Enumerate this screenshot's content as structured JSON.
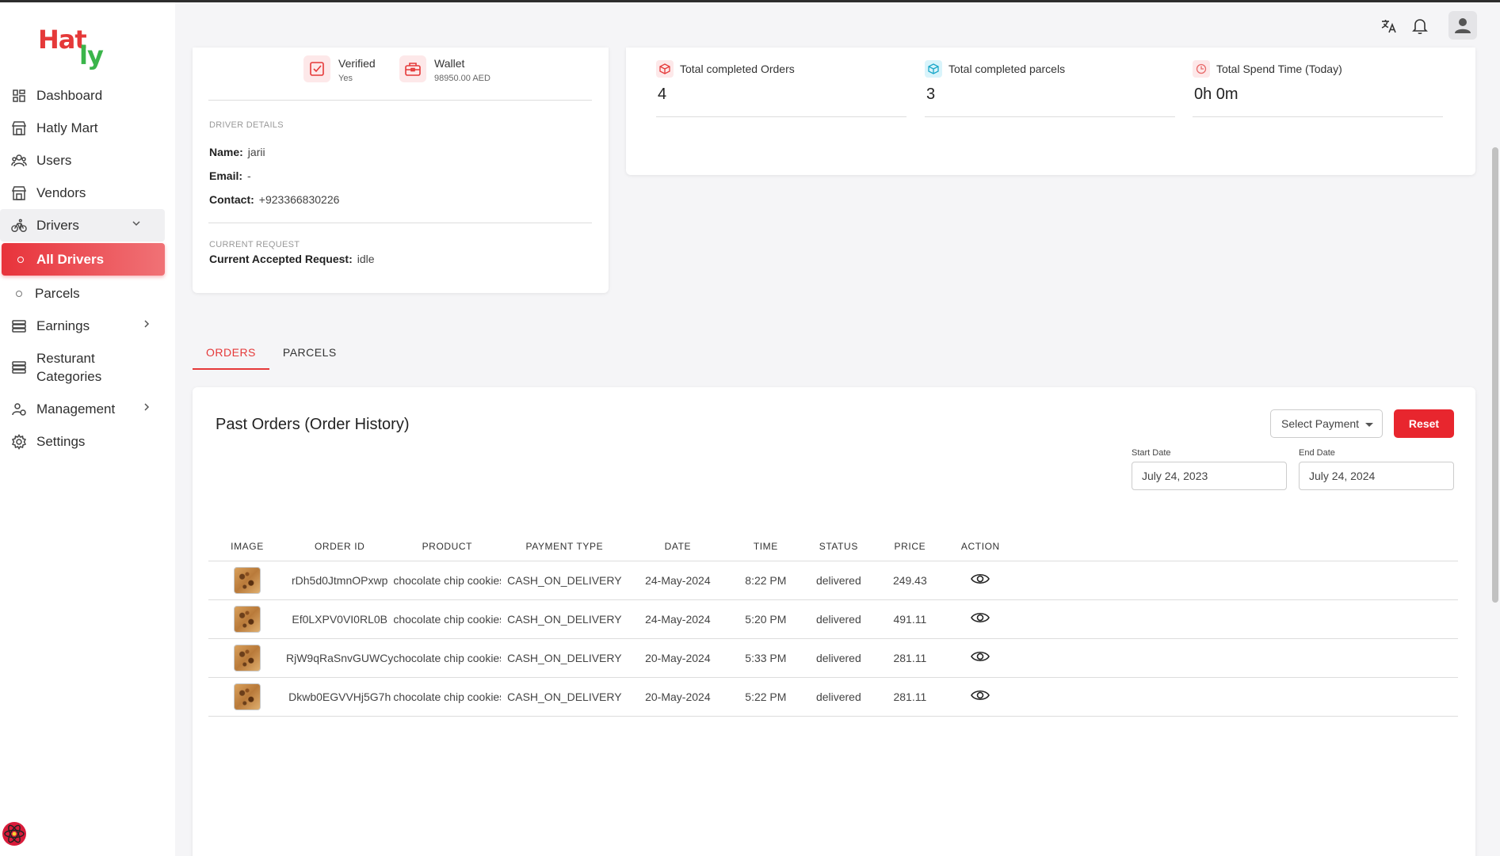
{
  "brand": {
    "part1": "Hat",
    "part2": "ly"
  },
  "sidebar": {
    "items": [
      {
        "label": "Dashboard",
        "icon": "dashboard-icon"
      },
      {
        "label": "Hatly Mart",
        "icon": "store-icon"
      },
      {
        "label": "Users",
        "icon": "users-icon"
      },
      {
        "label": "Vendors",
        "icon": "store-icon"
      },
      {
        "label": "Drivers",
        "icon": "bicycle-icon"
      },
      {
        "label": "All Drivers"
      },
      {
        "label": "Parcels"
      },
      {
        "label": "Earnings",
        "icon": "coins-icon"
      },
      {
        "label": "Resturant Categories",
        "icon": "coins-icon"
      },
      {
        "label": "Management",
        "icon": "management-icon"
      },
      {
        "label": "Settings",
        "icon": "gear-icon"
      }
    ]
  },
  "driver": {
    "verified_label": "Verified",
    "verified_value": "Yes",
    "wallet_label": "Wallet",
    "wallet_value": "98950.00 AED",
    "details_caption": "DRIVER DETAILS",
    "name_label": "Name:",
    "name_value": "jarii",
    "email_label": "Email:",
    "email_value": "-",
    "contact_label": "Contact:",
    "contact_value": "+923366830226",
    "request_caption": "CURRENT REQUEST",
    "request_label": "Current Accepted Request:",
    "request_value": "idle"
  },
  "stats": [
    {
      "title": "Total completed Orders",
      "value": "4",
      "color": "#e53939"
    },
    {
      "title": "Total completed parcels",
      "value": "3",
      "color": "#1aa7c9"
    },
    {
      "title": "Total Spend Time (Today)",
      "value": "0h 0m",
      "color": "#e86a6a"
    }
  ],
  "tabs": [
    {
      "label": "ORDERS",
      "active": true
    },
    {
      "label": "PARCELS",
      "active": false
    }
  ],
  "orders": {
    "title": "Past Orders (Order History)",
    "select_payment": "Select Payment",
    "reset_label": "Reset",
    "start_date_label": "Start Date",
    "start_date_value": "July 24, 2023",
    "end_date_label": "End Date",
    "end_date_value": "July 24, 2024",
    "columns": [
      "IMAGE",
      "ORDER ID",
      "PRODUCT",
      "PAYMENT TYPE",
      "DATE",
      "TIME",
      "STATUS",
      "PRICE",
      "ACTION"
    ],
    "rows": [
      {
        "order_id": "rDh5d0JtmnOPxwp",
        "product": "chocolate chip cookies",
        "payment": "CASH_ON_DELIVERY",
        "date": "24-May-2024",
        "time": "8:22 PM",
        "status": "delivered",
        "price": "249.43"
      },
      {
        "order_id": "Ef0LXPV0VI0RL0B",
        "product": "chocolate chip cookies",
        "payment": "CASH_ON_DELIVERY",
        "date": "24-May-2024",
        "time": "5:20 PM",
        "status": "delivered",
        "price": "491.11"
      },
      {
        "order_id": "RjW9qRaSnvGUWCy",
        "product": "chocolate chip cookies",
        "payment": "CASH_ON_DELIVERY",
        "date": "20-May-2024",
        "time": "5:33 PM",
        "status": "delivered",
        "price": "281.11"
      },
      {
        "order_id": "Dkwb0EGVVHj5G7h",
        "product": "chocolate chip cookies",
        "payment": "CASH_ON_DELIVERY",
        "date": "20-May-2024",
        "time": "5:22 PM",
        "status": "delivered",
        "price": "281.11"
      }
    ]
  }
}
